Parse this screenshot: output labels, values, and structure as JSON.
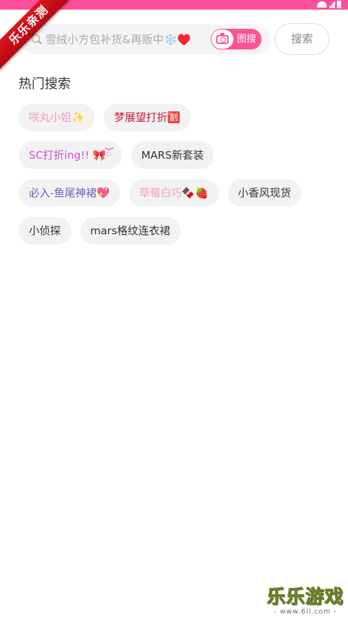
{
  "corner_badge": "乐乐亲测",
  "search": {
    "placeholder": "雪绒小方包补货&再贩中❄️♥️",
    "photo_search_label": "图搜",
    "search_button_label": "搜索"
  },
  "hot_search": {
    "title": "热门搜索",
    "rows": [
      [
        {
          "label": "咲丸小姐✨",
          "color": "#e8a3bf"
        },
        {
          "label": "梦展望打折🈹",
          "color": "#d0133a"
        }
      ],
      [
        {
          "label": "SC打折ing!! 🎀ོ",
          "color": "#d14ad8"
        },
        {
          "label": "MARS新套装",
          "color": "#333333"
        }
      ],
      [
        {
          "label": "必入-鱼尾神裙💖",
          "color": "#7458c7"
        },
        {
          "label": "草莓白巧🍫🍓",
          "color": "#f4a0c4"
        },
        {
          "label": "小香风现货",
          "color": "#333333"
        }
      ],
      [
        {
          "label": "小侦探",
          "color": "#333333"
        },
        {
          "label": "mars格纹连衣裙",
          "color": "#333333"
        }
      ]
    ]
  },
  "watermark": {
    "title": "乐乐游戏",
    "url": "- www.6ll.com -"
  },
  "colors": {
    "brand_pink": "#ff5294",
    "status_bar": "#ff4f9b",
    "ribbon_red": "#d11019"
  }
}
